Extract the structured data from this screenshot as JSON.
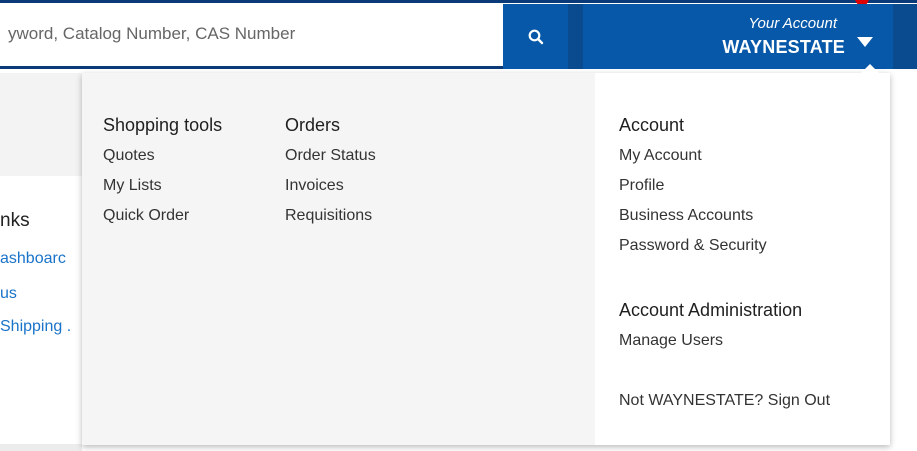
{
  "header": {
    "search": {
      "placeholder": "Search by Keyword, Catalog Number, CAS Number",
      "visible_text": "yword, Catalog Number, CAS Number",
      "button_icon": "search-icon"
    },
    "account": {
      "line1": "Your Account",
      "line2": "WAYNESTATE",
      "caret_icon": "caret-down-icon"
    },
    "colors": {
      "primary_blue": "#0758a8",
      "dark_blue": "#0a4a8f",
      "marker_red": "#e00000"
    }
  },
  "background_page": {
    "heading": "nks",
    "links": [
      "ashboarc",
      "us",
      "Shipping ."
    ]
  },
  "dropdown": {
    "columns": [
      {
        "title": "Shopping tools",
        "links": [
          "Quotes",
          "My Lists",
          "Quick Order"
        ]
      },
      {
        "title": "Orders",
        "links": [
          "Order Status",
          "Invoices",
          "Requisitions"
        ]
      },
      {
        "title": "Account",
        "links": [
          "My Account",
          "Profile",
          "Business Accounts",
          "Password & Security"
        ]
      }
    ],
    "admin": {
      "title": "Account Administration",
      "links": [
        "Manage Users"
      ]
    },
    "sign_out": "Not WAYNESTATE? Sign Out"
  }
}
